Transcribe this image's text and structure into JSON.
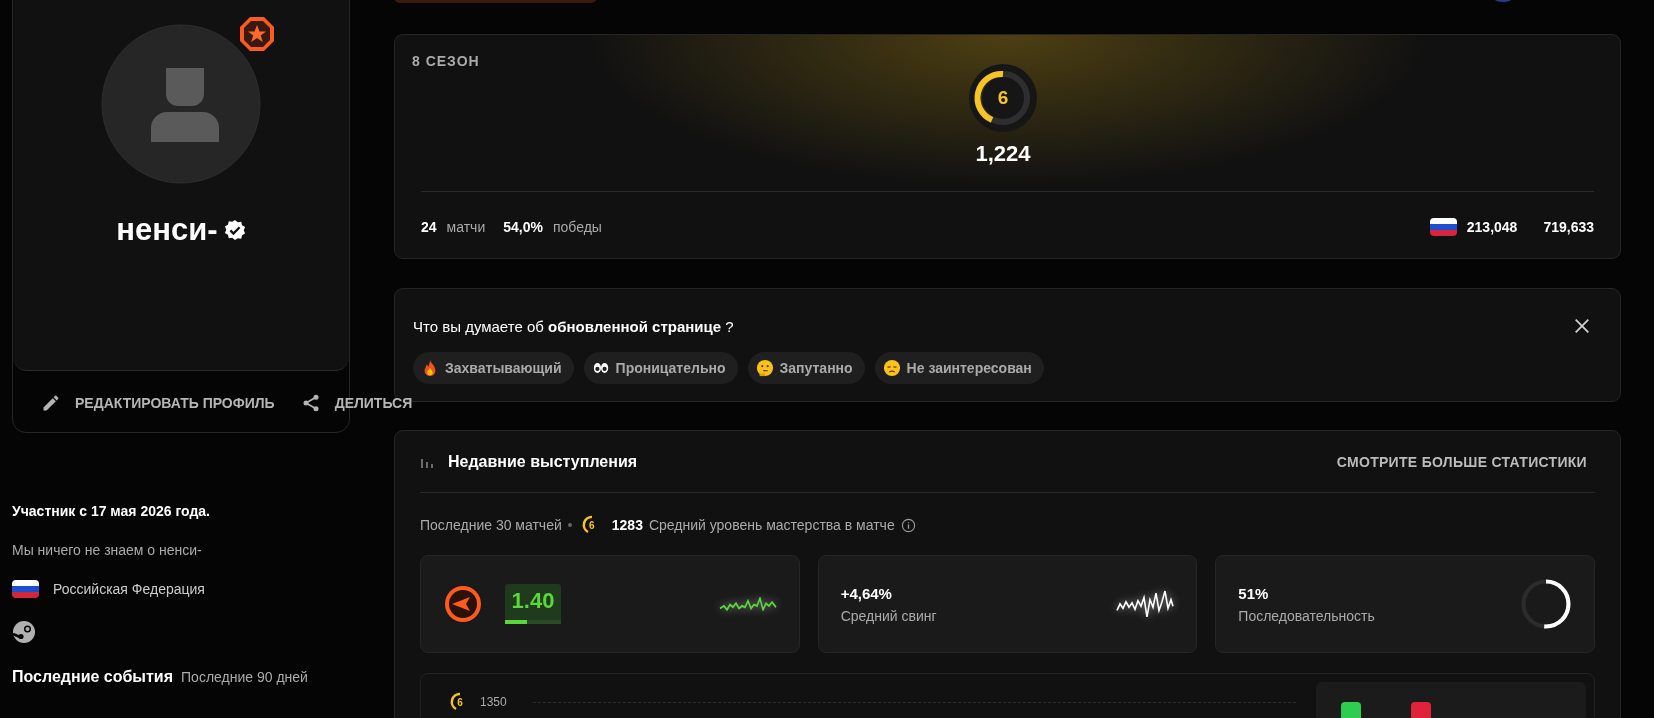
{
  "profile": {
    "nickname": "ненси-",
    "verified": true,
    "actions": [
      {
        "kind": "edit",
        "label": "РЕДАКТИРОВАТЬ ПРОФИЛЬ"
      },
      {
        "kind": "share",
        "label": "ДЕЛИТЬСЯ"
      }
    ]
  },
  "about": {
    "member_since": "Участник с 17 мая 2026 года.",
    "bio": "Мы ничего не знаем о ненси-",
    "country": "Российская Федерация"
  },
  "recent_events": {
    "title": "Последние события",
    "period": "Последние 90 дней"
  },
  "season": {
    "title": "8 СЕЗОН",
    "skill_level": "6",
    "elo": "1,224",
    "matches": "24",
    "matches_label": "матчи",
    "winrate": "54,0%",
    "winrate_label": "победы",
    "country_rank": "213,048",
    "world_rank": "719,633"
  },
  "feedback": {
    "question": "Что вы думаете об **обновленной странице** ?",
    "options": [
      {
        "kind": "fire",
        "label": "Захватывающий"
      },
      {
        "kind": "eyes",
        "label": "Проницательно"
      },
      {
        "kind": "thinking",
        "label": "Запутанно"
      },
      {
        "kind": "sad",
        "label": "Не заинтересован"
      }
    ]
  },
  "recent": {
    "title": "Недавние выступления",
    "link": "СМОТРИТЕ БОЛЬШЕ СТАТИСТИКИ",
    "summary": "Последние 30 матчей",
    "skill_level": "6",
    "avg_elo": "1283",
    "avg_label": "Средний уровень мастерства в матче",
    "cards": [
      {
        "kind": "kd",
        "value": "1.40",
        "level": 0.4
      },
      {
        "kind": "swing",
        "value": "+4,64%",
        "label": "Средний свинг"
      },
      {
        "kind": "consistency",
        "value": "51%",
        "label": "Последовательность",
        "level": 0.51
      }
    ],
    "chart_tick": "1350",
    "chart_skill_level": "6"
  }
}
